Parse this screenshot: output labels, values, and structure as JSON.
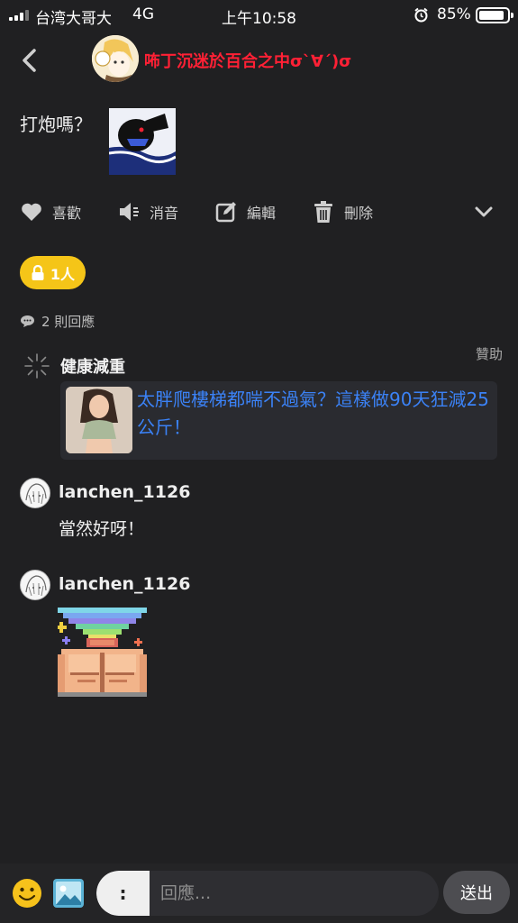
{
  "status_bar": {
    "carrier": "台湾大哥大",
    "network": "4G",
    "time": "上午10:58",
    "battery": "85%"
  },
  "header": {
    "username": "咘丁沉迷於百合之中σ`∀´)σ"
  },
  "post": {
    "text": "打炮嗎？"
  },
  "actions": {
    "like": "喜歡",
    "mute": "消音",
    "edit": "編輯",
    "delete": "刪除"
  },
  "lock": {
    "label": "1人"
  },
  "comments_count": "2 則回應",
  "ad": {
    "sponsor": "贊助",
    "name": "健康減重",
    "text": "太胖爬樓梯都喘不過氣？這樣做90天狂減25公斤！"
  },
  "comments": [
    {
      "user": "lanchen_1126",
      "text": "當然好呀！"
    },
    {
      "user": "lanchen_1126"
    }
  ],
  "input": {
    "prefix": ":",
    "placeholder": "回應...",
    "send": "送出"
  },
  "colors": {
    "background": "#202022",
    "accent_name": "#ff2035",
    "lock": "#f5c518",
    "link": "#3b82f6"
  }
}
